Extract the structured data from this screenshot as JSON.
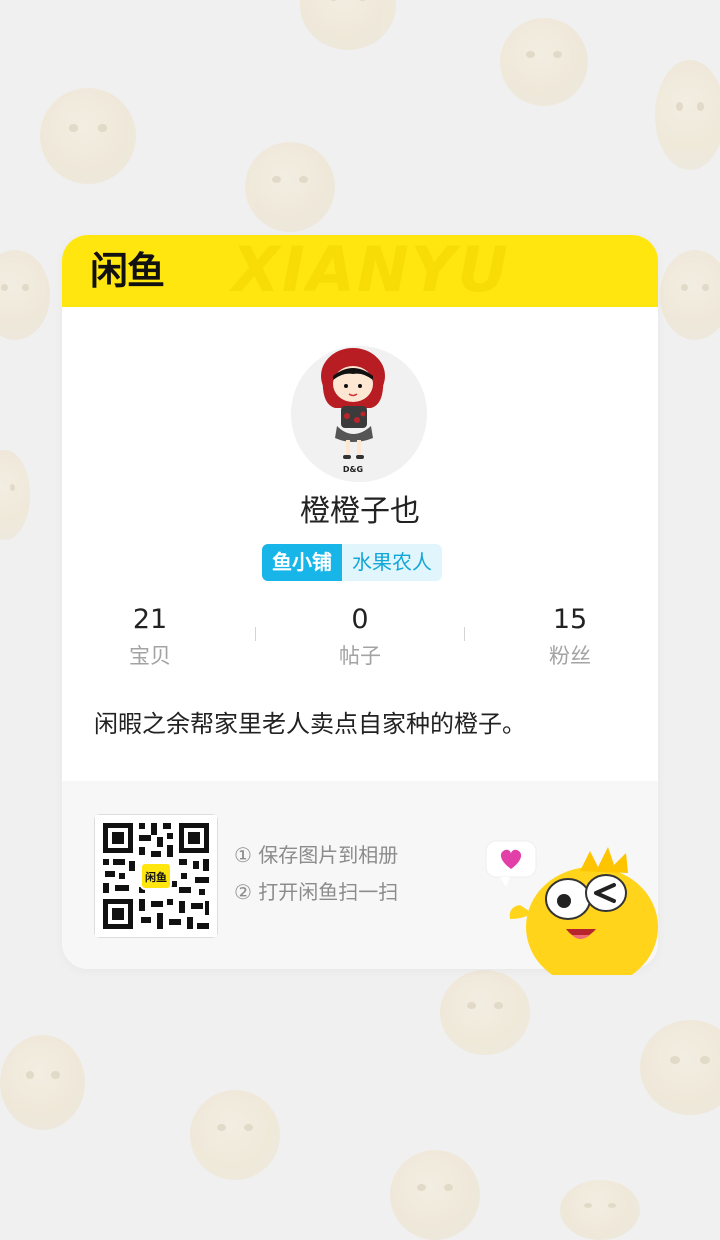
{
  "brand": {
    "logo_text": "闲鱼",
    "watermark": "XIANYU"
  },
  "profile": {
    "username": "橙橙子也",
    "shop_tag": "鱼小铺",
    "shop_label": "水果农人",
    "avatar_caption": "D&G"
  },
  "stats": [
    {
      "value": "21",
      "label": "宝贝"
    },
    {
      "value": "0",
      "label": "帖子"
    },
    {
      "value": "15",
      "label": "粉丝"
    }
  ],
  "bio": "闲暇之余帮家里老人卖点自家种的橙子。",
  "footer": {
    "qr_badge": "闲鱼",
    "steps": [
      "① 保存图片到相册",
      "② 打开闲鱼扫一扫"
    ]
  },
  "colors": {
    "brand_yellow": "#ffe60f",
    "shop_tag_blue": "#18b6e8",
    "shop_label_bg": "#e1f6fc",
    "muted_text": "#a3a3a3"
  },
  "icons": {
    "qr": "qr-code-icon",
    "mascot": "fish-mascot-icon",
    "heart": "heart-bubble-icon"
  }
}
